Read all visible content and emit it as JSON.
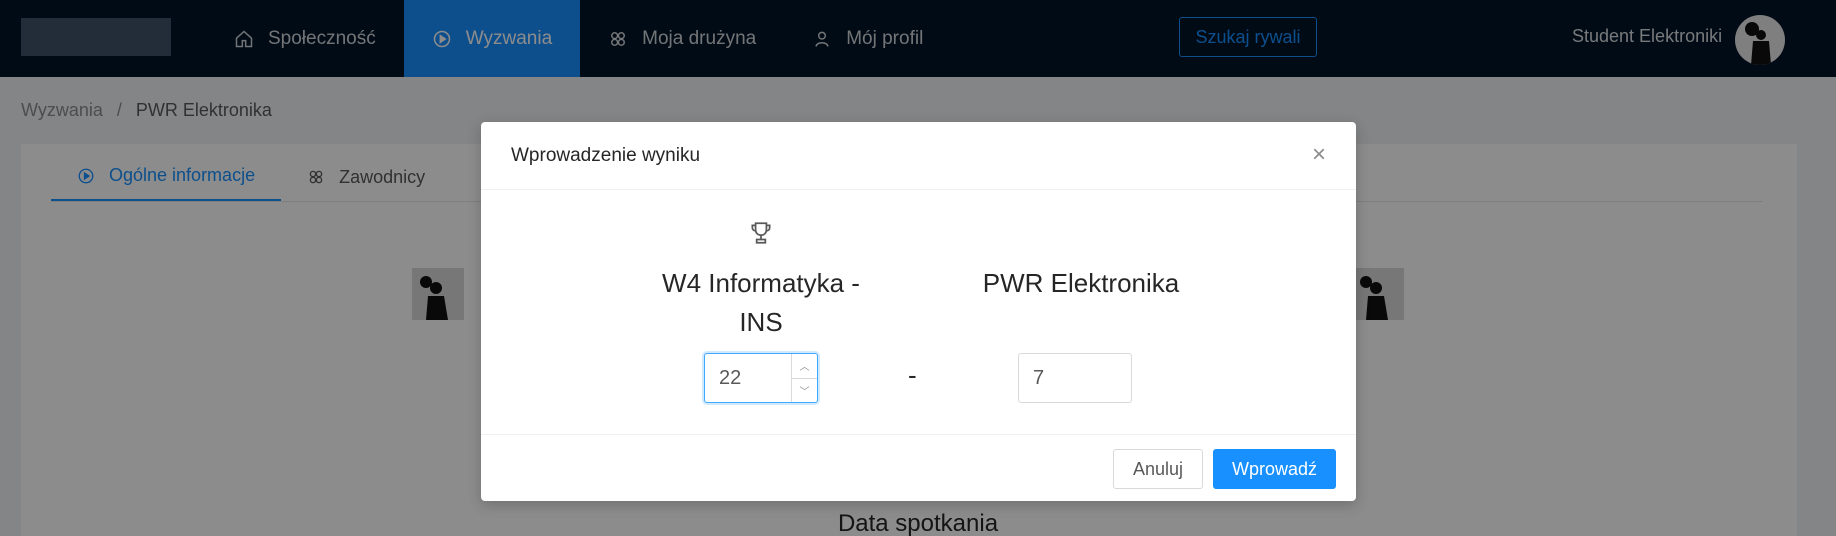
{
  "header": {
    "nav": [
      {
        "label": "Społeczność",
        "icon": "home-icon"
      },
      {
        "label": "Wyzwania",
        "icon": "play-circle-icon",
        "active": true
      },
      {
        "label": "Moja drużyna",
        "icon": "team-icon"
      },
      {
        "label": "Mój profil",
        "icon": "user-icon"
      }
    ],
    "search_button": "Szukaj rywali",
    "user_name": "Student Elektroniki"
  },
  "breadcrumb": {
    "parent": "Wyzwania",
    "separator": "/",
    "current": "PWR Elektronika"
  },
  "tabs": [
    {
      "label": "Ogólne informacje",
      "icon": "play-circle-icon",
      "active": true
    },
    {
      "label": "Zawodnicy",
      "icon": "team-icon"
    }
  ],
  "background": {
    "date_heading": "Data spotkania"
  },
  "modal": {
    "title": "Wprowadzenie wyniku",
    "team_left": "W4 Informatyka - INS",
    "team_right": "PWR Elektronika",
    "separator": "-",
    "score_left": "22",
    "score_right": "7",
    "cancel_label": "Anuluj",
    "submit_label": "Wprowadź"
  },
  "colors": {
    "primary": "#1890ff",
    "header_bg": "#001529"
  }
}
